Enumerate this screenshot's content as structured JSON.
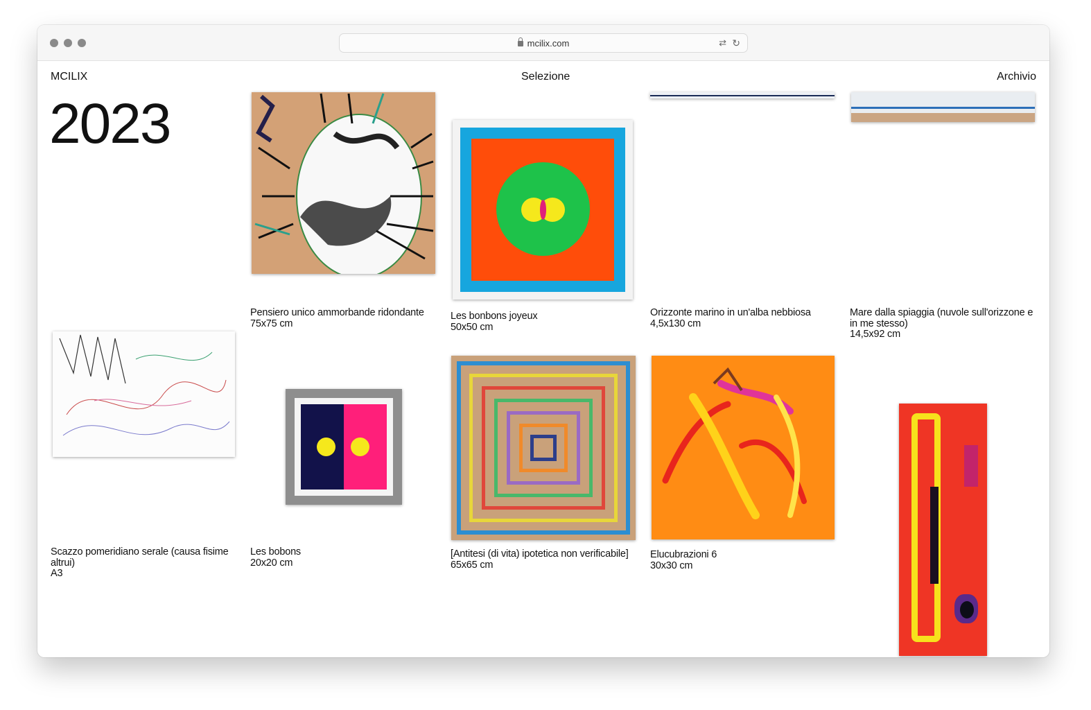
{
  "browser": {
    "url": "mcilix.com"
  },
  "header": {
    "brand": "MCILIX",
    "nav_center": "Selezione",
    "nav_right": "Archivio"
  },
  "year": "2023",
  "artworks": [
    {
      "title": "Pensiero unico ammorbande ridondante",
      "size": "75x75 cm"
    },
    {
      "title": "Les bonbons joyeux",
      "size": "50x50 cm"
    },
    {
      "title": "Orizzonte marino in un'alba nebbiosa",
      "size": "4,5x130 cm"
    },
    {
      "title": "Mare dalla spiaggia (nuvole sull'orizzone e in me stesso)",
      "size": "14,5x92 cm"
    },
    {
      "title": "Scazzo pomeridiano serale (causa fisime altrui)",
      "size": "A3"
    },
    {
      "title": "Les bobons",
      "size": "20x20 cm"
    },
    {
      "title": "[Antitesi (di vita) ipotetica non verificabile]",
      "size": "65x65 cm"
    },
    {
      "title": "Elucubrazioni 6",
      "size": "30x30 cm"
    }
  ],
  "colors": {
    "cardboard": "#d3a176",
    "cyan_frame": "#17a6de",
    "orange_red": "#ff4d0a",
    "green": "#1ec24a",
    "yellow": "#f5e81c",
    "navy": "#12124a",
    "pink": "#ff1f7a",
    "bright_orange": "#ff8c14",
    "red": "#ef3525"
  }
}
